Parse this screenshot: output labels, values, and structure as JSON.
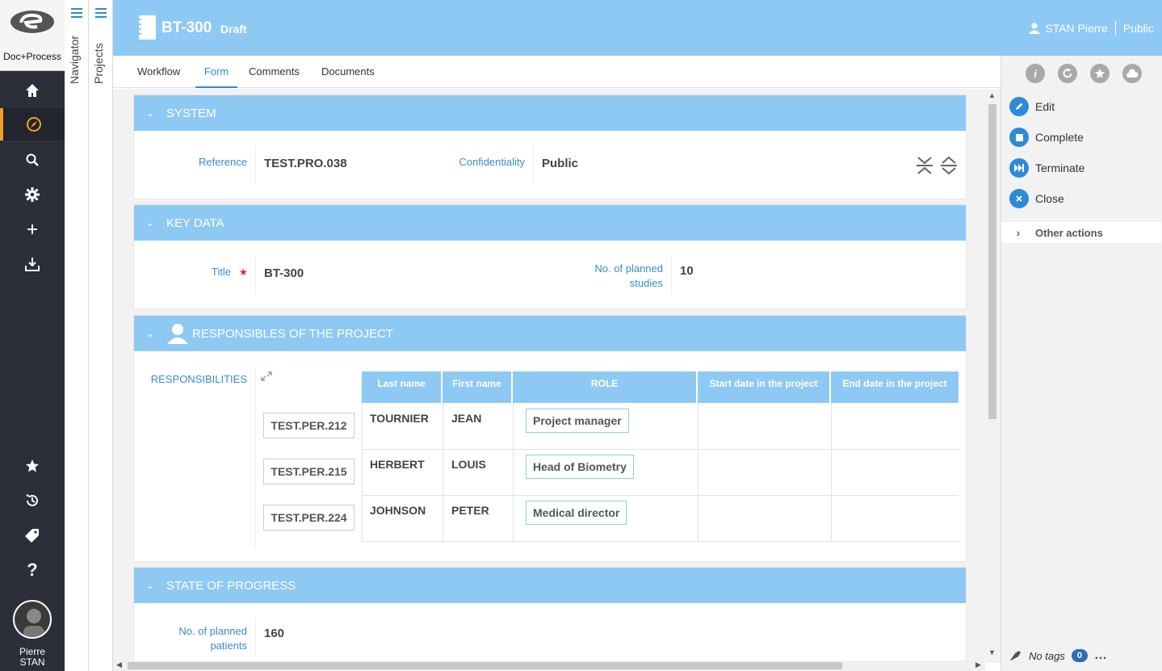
{
  "app": {
    "brand": "Doc+Process"
  },
  "user": {
    "first": "Pierre",
    "last": "STAN",
    "full": "STAN Pierre",
    "visibility": "Public"
  },
  "panels": {
    "navigator": "Navigator",
    "projects": "Projects"
  },
  "header": {
    "title": "BT-300",
    "status": "Draft"
  },
  "tabs": [
    "Workflow",
    "Form",
    "Comments",
    "Documents"
  ],
  "sections": {
    "system": {
      "title": "SYSTEM",
      "reference_label": "Reference",
      "reference_value": "TEST.PRO.038",
      "confidentiality_label": "Confidentiality",
      "confidentiality_value": "Public"
    },
    "keydata": {
      "title": "KEY DATA",
      "title_label": "Title",
      "title_value": "BT-300",
      "studies_label_1": "No. of planned",
      "studies_label_2": "studies",
      "studies_value": "10"
    },
    "responsibles": {
      "title": "RESPONSIBLES OF THE PROJECT",
      "label": "RESPONSIBILITIES",
      "columns": [
        "Last name",
        "First name",
        "ROLE",
        "Start date in the project",
        "End date in the project"
      ],
      "rows": [
        {
          "ref": "TEST.PER.212",
          "last": "TOURNIER",
          "first": "JEAN",
          "role": "Project manager"
        },
        {
          "ref": "TEST.PER.215",
          "last": "HERBERT",
          "first": "LOUIS",
          "role": "Head of Biometry"
        },
        {
          "ref": "TEST.PER.224",
          "last": "JOHNSON",
          "first": "PETER",
          "role": "Medical director"
        }
      ]
    },
    "progress": {
      "title": "STATE OF PROGRESS",
      "patients_label_1": "No. of planned",
      "patients_label_2": "patients",
      "patients_value": "160"
    }
  },
  "actions": {
    "edit": "Edit",
    "complete": "Complete",
    "terminate": "Terminate",
    "close": "Close",
    "other": "Other actions"
  },
  "tags": {
    "label": "No tags",
    "count": "0"
  }
}
